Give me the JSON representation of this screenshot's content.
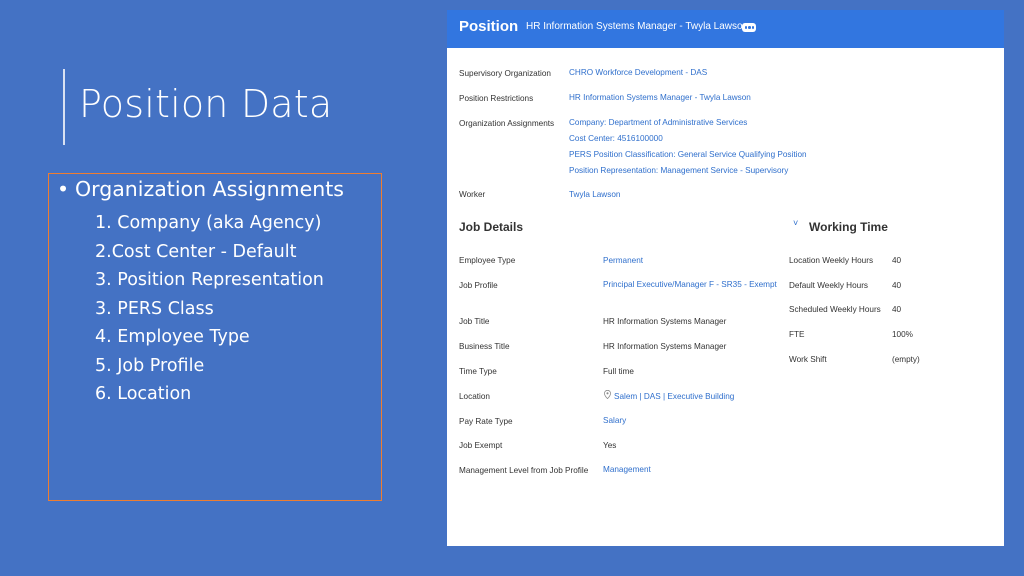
{
  "slide": {
    "title": "Position Data",
    "bullet": "Organization Assignments",
    "items": [
      "1. Company (aka Agency)",
      "2.Cost Center - Default",
      "3. Position Representation",
      "3. PERS Class",
      "4. Employee Type",
      "5. Job Profile",
      "6. Location"
    ]
  },
  "panel": {
    "title": "Position",
    "subtitle": "HR Information Systems Manager - Twyla Lawson",
    "more_icon": "ellipsis-icon",
    "supervisory_org": {
      "label": "Supervisory Organization",
      "value": "CHRO Workforce Development - DAS"
    },
    "position_restrictions": {
      "label": "Position Restrictions",
      "value": "HR Information Systems Manager - Twyla Lawson"
    },
    "org_assignments": {
      "label": "Organization Assignments",
      "values": [
        "Company: Department of Administrative Services",
        "Cost Center: 4516100000",
        "PERS Position Classification: General Service Qualifying Position",
        "Position Representation: Management Service - Supervisory"
      ]
    },
    "worker": {
      "label": "Worker",
      "value": "Twyla Lawson"
    },
    "job_details": {
      "title": "Job Details",
      "employee_type": {
        "label": "Employee Type",
        "value": "Permanent"
      },
      "job_profile": {
        "label": "Job Profile",
        "value": "Principal Executive/Manager F - SR35 - Exempt"
      },
      "job_title": {
        "label": "Job Title",
        "value": "HR Information Systems Manager"
      },
      "business_title": {
        "label": "Business Title",
        "value": "HR Information Systems Manager"
      },
      "time_type": {
        "label": "Time Type",
        "value": "Full time"
      },
      "location": {
        "label": "Location",
        "value": "Salem | DAS | Executive Building",
        "icon": "location-pin-icon"
      },
      "pay_rate_type": {
        "label": "Pay Rate Type",
        "value": "Salary"
      },
      "job_exempt": {
        "label": "Job Exempt",
        "value": "Yes"
      },
      "management_level": {
        "label": "Management Level from Job Profile",
        "value": "Management"
      }
    },
    "working_time": {
      "title": "Working Time",
      "chevron": "˅",
      "location_weekly_hours": {
        "label": "Location Weekly Hours",
        "value": "40"
      },
      "default_weekly_hours": {
        "label": "Default Weekly Hours",
        "value": "40"
      },
      "scheduled_weekly_hours": {
        "label": "Scheduled Weekly Hours",
        "value": "40"
      },
      "fte": {
        "label": "FTE",
        "value": "100%"
      },
      "work_shift": {
        "label": "Work Shift",
        "value": "(empty)"
      }
    }
  }
}
